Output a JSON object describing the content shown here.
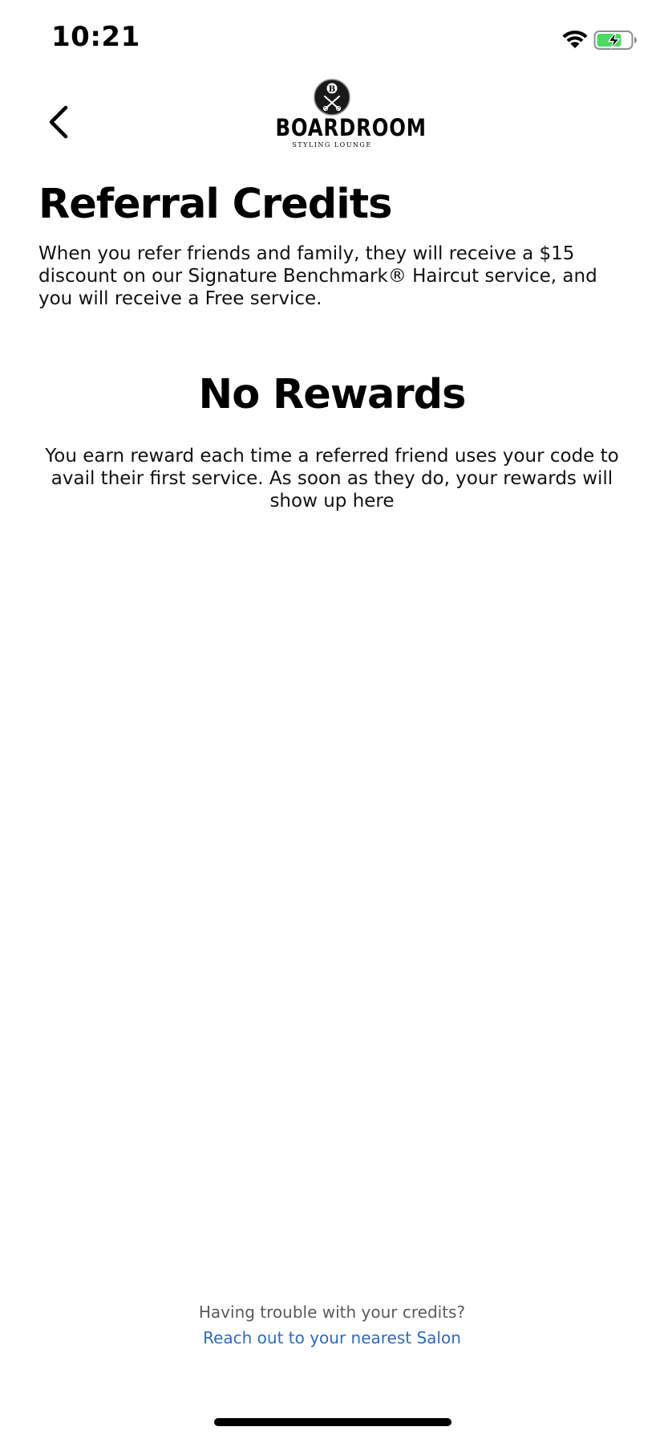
{
  "status_bar": {
    "time": "10:21",
    "wifi_icon": "wifi-icon",
    "battery_icon": "battery-charging-icon",
    "battery_color": "#4cd964"
  },
  "nav": {
    "back_icon": "chevron-left-icon",
    "logo": {
      "emblem_letter": "B",
      "wordmark": "BOARDROOM",
      "tagline": "STYLING LOUNGE"
    }
  },
  "content": {
    "title": "Referral Credits",
    "intro": "When you refer friends and family, they will receive a $15 discount on our Signature Benchmark® Haircut service, and you will receive a Free service.",
    "empty_state": {
      "title": "No Rewards",
      "text": "You earn reward each time a referred friend uses your code to avail their first service. As soon as they do, your rewards will show up here"
    }
  },
  "footer": {
    "question": "Having trouble with your credits?",
    "link": "Reach out to your nearest Salon",
    "link_color": "#2e6bb8"
  }
}
